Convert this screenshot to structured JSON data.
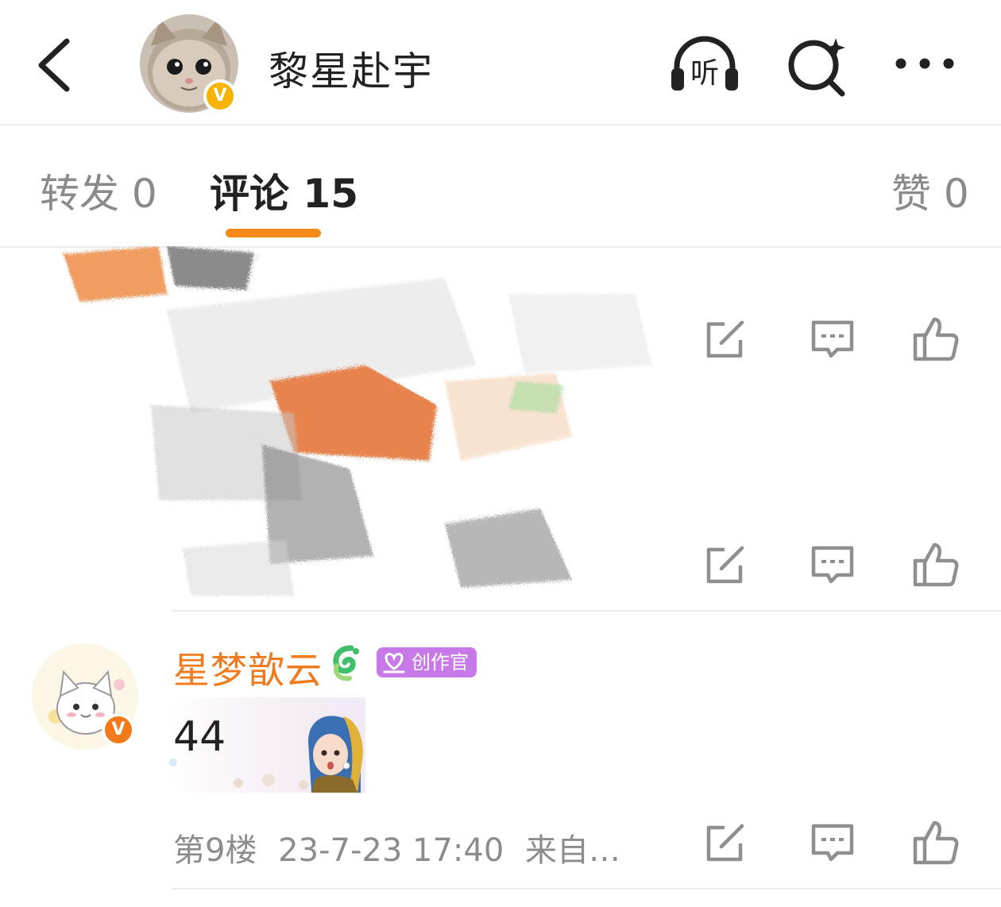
{
  "header": {
    "title": "黎星赴宇",
    "avatar_badge": "V",
    "listen_label": "听"
  },
  "tabs": [
    {
      "label": "转发 0"
    },
    {
      "label": "评论 15"
    },
    {
      "label": "赞 0"
    }
  ],
  "comment": {
    "username": "星梦歆云",
    "avatar_badge": "V",
    "tag_label": "创作官",
    "text": "44",
    "floor": "第9楼",
    "timestamp": "23-7-23 17:40",
    "source": "来自…"
  },
  "colors": {
    "accent_orange": "#f58a18",
    "username_orange": "#f07a1e",
    "verified_gold": "#f6b400",
    "verified_orange": "#f27a1a",
    "tag_purple": "#c77ae7",
    "icon_gray": "#8f8f8f"
  },
  "icons": [
    "back-arrow-icon",
    "listen-headphones-icon",
    "search-sparkle-icon",
    "more-dots-icon",
    "share-icon",
    "comment-icon",
    "like-icon"
  ]
}
